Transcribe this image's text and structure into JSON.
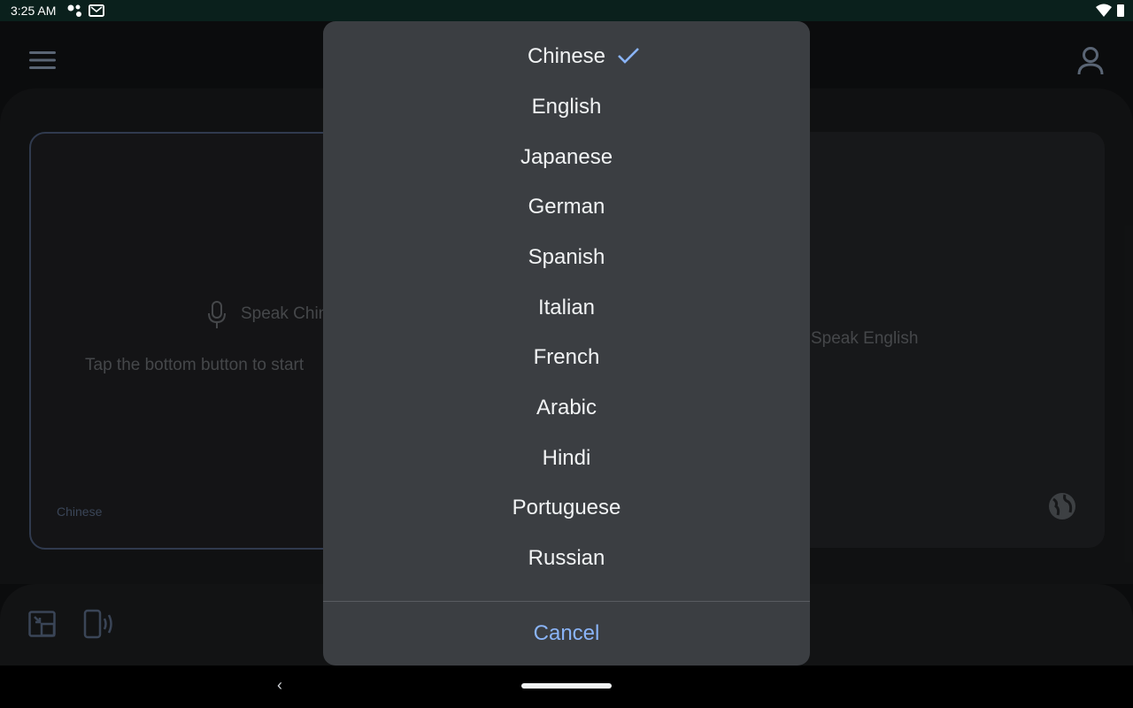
{
  "status_bar": {
    "time": "3:25 AM",
    "icons": [
      "assistant-icon",
      "mail-icon",
      "wifi-icon",
      "battery-icon"
    ]
  },
  "app_bar": {
    "icons": [
      "menu-icon",
      "account-icon"
    ]
  },
  "source_card": {
    "speak_label": "Speak Chinese",
    "hint": "Tap the bottom button to start",
    "language": "Chinese"
  },
  "target_card": {
    "speak_label": "Speak English",
    "icon": "globe-icon"
  },
  "bottom_bar": {
    "icons": [
      "picture-in-picture-icon",
      "phone-speaker-icon"
    ]
  },
  "language_dialog": {
    "options": [
      {
        "label": "Chinese",
        "selected": true
      },
      {
        "label": "English",
        "selected": false
      },
      {
        "label": "Japanese",
        "selected": false
      },
      {
        "label": "German",
        "selected": false
      },
      {
        "label": "Spanish",
        "selected": false
      },
      {
        "label": "Italian",
        "selected": false
      },
      {
        "label": "French",
        "selected": false
      },
      {
        "label": "Arabic",
        "selected": false
      },
      {
        "label": "Hindi",
        "selected": false
      },
      {
        "label": "Portuguese",
        "selected": false
      },
      {
        "label": "Russian",
        "selected": false
      }
    ],
    "cancel_label": "Cancel"
  },
  "nav_bar": {
    "icons": [
      "back-icon",
      "home-handle"
    ]
  },
  "colors": {
    "accent": "#8ab4f8",
    "dialog_bg": "#3b3e42",
    "status_bar_bg": "#0a201c"
  }
}
